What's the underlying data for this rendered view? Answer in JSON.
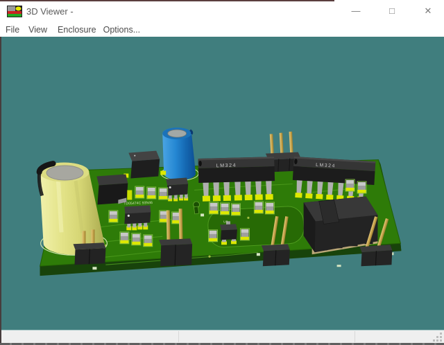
{
  "window": {
    "title": "3D Viewer -",
    "controls": {
      "minimize": "—",
      "maximize": "□",
      "close": "✕"
    }
  },
  "menu": {
    "items": [
      {
        "label": "File"
      },
      {
        "label": "View"
      },
      {
        "label": "Enclosure"
      },
      {
        "label": "Options..."
      }
    ]
  },
  "viewport": {
    "background_color": "#407E7E",
    "board": {
      "top_color": "#2E7B08",
      "side_color": "#1A4A08",
      "pad_color": "#DDE800",
      "trace_color": "#4E9C1E",
      "silkscreen_color": "#CFE3AE"
    },
    "silkscreen": {
      "dip1": "LM324",
      "dip2": "LM324",
      "soic1": "TD05474C 93N46",
      "sot": "U8"
    },
    "components": [
      {
        "name": "yellow-electrolytic-capacitor",
        "type": "radial electrolytic capacitor",
        "color": "#DCDC78"
      },
      {
        "name": "blue-electrolytic-capacitor",
        "type": "radial electrolytic capacitor",
        "color": "#1E7CC8"
      },
      {
        "name": "dip14-ic-1",
        "type": "DIP-14 IC",
        "label": "LM324"
      },
      {
        "name": "dip14-ic-2",
        "type": "DIP-14 IC",
        "label": "LM324"
      },
      {
        "name": "soic8-ic-1",
        "type": "SOIC-8 IC"
      },
      {
        "name": "soic8-ic-2",
        "type": "SOIC-8 IC"
      },
      {
        "name": "black-connector",
        "type": "molded connector block"
      },
      {
        "name": "black-module",
        "type": "molded SMD component"
      },
      {
        "name": "black-chip",
        "type": "square SMD chip"
      },
      {
        "name": "pin-header-3pin-top",
        "type": "pin header, gold pins"
      },
      {
        "name": "pin-header-2pin-under-cap",
        "type": "pin header socket"
      },
      {
        "name": "pin-header-2pin-middle",
        "type": "pin header, gold pins"
      },
      {
        "name": "pin-header-2pin-right",
        "type": "pin header, gold pins"
      },
      {
        "name": "pin-header-2pin-far-right",
        "type": "pin header, gold pins"
      },
      {
        "name": "sot23-transistor",
        "type": "SOT-23",
        "label": "U8"
      },
      {
        "name": "smd-passives",
        "type": "SMD resistor/capacitor",
        "count": 18
      }
    ]
  },
  "status_bar": {
    "sections": [
      {
        "text": ""
      },
      {
        "text": ""
      },
      {
        "text": ""
      }
    ]
  }
}
